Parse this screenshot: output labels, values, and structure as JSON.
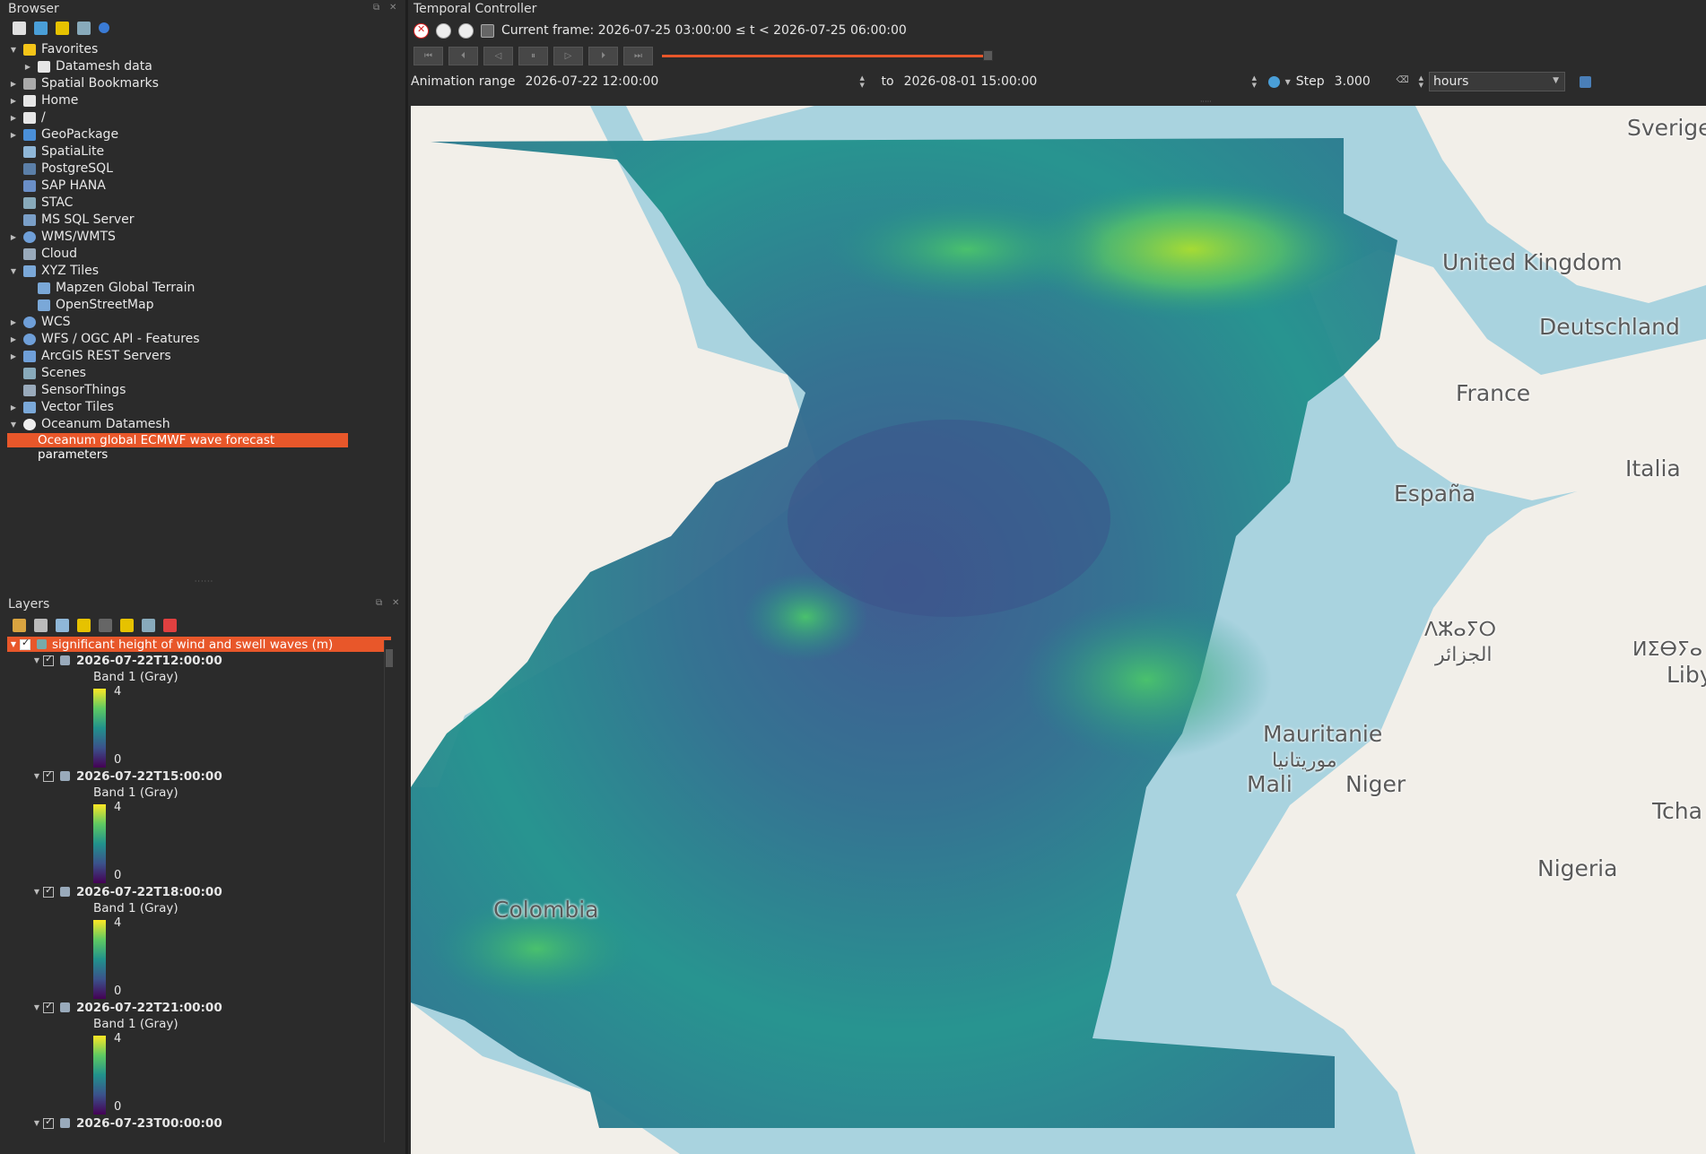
{
  "browser": {
    "title": "Browser",
    "items": [
      {
        "label": "Favorites",
        "icon": "star-icon",
        "expanded": true,
        "indent": 0
      },
      {
        "label": "Datamesh data",
        "icon": "folder-icon",
        "expanded": false,
        "indent": 1
      },
      {
        "label": "Spatial Bookmarks",
        "icon": "bookmark-icon",
        "expanded": false,
        "indent": 0
      },
      {
        "label": "Home",
        "icon": "home-icon",
        "expanded": false,
        "indent": 0
      },
      {
        "label": "/",
        "icon": "folder-icon",
        "expanded": false,
        "indent": 0
      },
      {
        "label": "GeoPackage",
        "icon": "geopackage-icon",
        "expanded": false,
        "indent": 0
      },
      {
        "label": "SpatiaLite",
        "icon": "spatialite-icon",
        "expanded": null,
        "indent": 0
      },
      {
        "label": "PostgreSQL",
        "icon": "postgresql-icon",
        "expanded": null,
        "indent": 0
      },
      {
        "label": "SAP HANA",
        "icon": "saphana-icon",
        "expanded": null,
        "indent": 0
      },
      {
        "label": "STAC",
        "icon": "stac-icon",
        "expanded": null,
        "indent": 0
      },
      {
        "label": "MS SQL Server",
        "icon": "mssql-icon",
        "expanded": null,
        "indent": 0
      },
      {
        "label": "WMS/WMTS",
        "icon": "globe-icon",
        "expanded": false,
        "indent": 0
      },
      {
        "label": "Cloud",
        "icon": "cloud-icon",
        "expanded": null,
        "indent": 0
      },
      {
        "label": "XYZ Tiles",
        "icon": "grid-icon",
        "expanded": true,
        "indent": 0
      },
      {
        "label": "Mapzen Global Terrain",
        "icon": "grid-icon",
        "expanded": null,
        "indent": 1
      },
      {
        "label": "OpenStreetMap",
        "icon": "grid-icon",
        "expanded": null,
        "indent": 1
      },
      {
        "label": "WCS",
        "icon": "globe-icon",
        "expanded": false,
        "indent": 0
      },
      {
        "label": "WFS / OGC API - Features",
        "icon": "globe-icon",
        "expanded": false,
        "indent": 0
      },
      {
        "label": "ArcGIS REST Servers",
        "icon": "arcgis-icon",
        "expanded": false,
        "indent": 0
      },
      {
        "label": "Scenes",
        "icon": "scenes-icon",
        "expanded": null,
        "indent": 0
      },
      {
        "label": "SensorThings",
        "icon": "sensor-icon",
        "expanded": null,
        "indent": 0
      },
      {
        "label": "Vector Tiles",
        "icon": "grid-icon",
        "expanded": false,
        "indent": 0
      },
      {
        "label": "Oceanum Datamesh",
        "icon": "datamesh-icon",
        "expanded": true,
        "indent": 0
      }
    ],
    "selected_item": "Oceanum global ECMWF wave forecast parameters"
  },
  "layers": {
    "title": "Layers",
    "group_label": "significant height of wind and swell waves (m)",
    "band_label": "Band 1 (Gray)",
    "ramp_max": "4",
    "ramp_min": "0",
    "sublayers": [
      {
        "label": "2026-07-22T12:00:00"
      },
      {
        "label": "2026-07-22T15:00:00"
      },
      {
        "label": "2026-07-22T18:00:00"
      },
      {
        "label": "2026-07-22T21:00:00"
      },
      {
        "label": "2026-07-23T00:00:00"
      }
    ]
  },
  "temporal": {
    "title": "Temporal Controller",
    "current_frame": "Current frame: 2026-07-25 03:00:00 ≤ t < 2026-07-25 06:00:00",
    "animation_range_label": "Animation range",
    "range_start": "2026-07-22 12:00:00",
    "to_label": "to",
    "range_end": "2026-08-01 15:00:00",
    "step_label": "Step",
    "step_value": "3.000",
    "step_unit": "hours",
    "progress": 1.0
  },
  "map": {
    "labels": [
      {
        "text": "Sverige"
      },
      {
        "text": "United Kingdom"
      },
      {
        "text": "Deutschland"
      },
      {
        "text": "France"
      },
      {
        "text": "Italia"
      },
      {
        "text": "España"
      },
      {
        "text": "ⴷⵣⴰⵢⵔ"
      },
      {
        "text": "الجزائر"
      },
      {
        "text": "ⵍⵉⴱⵢⴰ"
      },
      {
        "text": "Liby"
      },
      {
        "text": "Mauritanie"
      },
      {
        "text": "موريتانيا"
      },
      {
        "text": "Mali"
      },
      {
        "text": "Niger"
      },
      {
        "text": "Tcha"
      },
      {
        "text": "Nigeria"
      },
      {
        "text": "Colombia"
      }
    ],
    "land_color": "#f2efe9",
    "water_color": "#a9d3df"
  }
}
